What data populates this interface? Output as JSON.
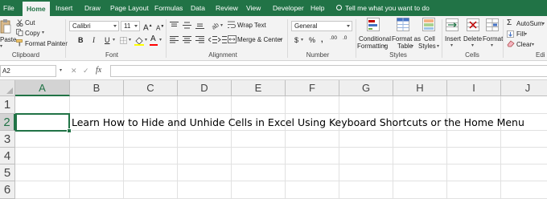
{
  "menu": {
    "tabs": [
      "File",
      "Home",
      "Insert",
      "Draw",
      "Page Layout",
      "Formulas",
      "Data",
      "Review",
      "View",
      "Developer",
      "Help"
    ],
    "active_tab": "Home",
    "tell_me": "Tell me what you want to do"
  },
  "ribbon": {
    "clipboard": {
      "paste": "Paste",
      "cut": "Cut",
      "copy": "Copy",
      "format_painter": "Format Painter",
      "group_label": "Clipboard"
    },
    "font": {
      "font_name": "Calibri",
      "font_size": "11",
      "grow_label": "A",
      "shrink_label": "A",
      "bold": "B",
      "italic": "I",
      "underline": "U",
      "fill_label": "",
      "font_color_label": "A",
      "group_label": "Font"
    },
    "alignment": {
      "wrap_text": "Wrap Text",
      "merge_center": "Merge & Center",
      "group_label": "Alignment"
    },
    "number": {
      "format": "General",
      "currency": "$",
      "percent": "%",
      "comma": ",",
      "inc_decimal": ".00",
      "dec_decimal": ".0",
      "group_label": "Number"
    },
    "styles": {
      "conditional_formatting": [
        "Conditional",
        "Formatting"
      ],
      "format_as_table": [
        "Format as",
        "Table"
      ],
      "cell_styles": [
        "Cell",
        "Styles"
      ],
      "group_label": "Styles"
    },
    "cells": {
      "insert": "Insert",
      "delete": "Delete",
      "format": "Format",
      "group_label": "Cells"
    },
    "editing": {
      "autosum": "AutoSum",
      "fill": "Fill",
      "clear": "Clear",
      "group_label": "Edi"
    },
    "colors": {
      "highlight": "#ffff00",
      "font_color": "#ff0000",
      "accent": "#217346"
    }
  },
  "formula_bar": {
    "name_box": "A2",
    "fx_label": "fx",
    "content": ""
  },
  "sheet": {
    "columns": [
      "A",
      "B",
      "C",
      "D",
      "E",
      "F",
      "G",
      "H",
      "I",
      "J"
    ],
    "rows": [
      "1",
      "2",
      "3",
      "4",
      "5",
      "6"
    ],
    "selected_cell": "A2",
    "cell_b2": "Learn How to Hide and Unhide Cells in Excel Using Keyboard Shortcuts or the Home Menu"
  }
}
